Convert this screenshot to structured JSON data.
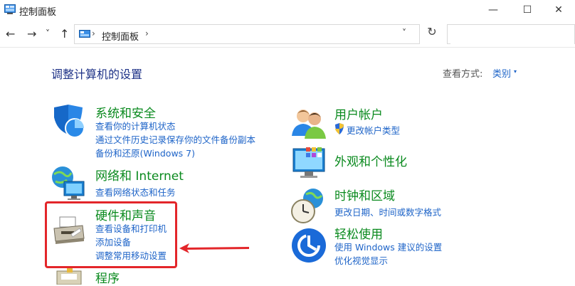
{
  "window": {
    "title": "控制面板",
    "minimize_glyph": "—",
    "maximize_glyph": "☐",
    "close_glyph": "✕"
  },
  "address_bar": {
    "back_glyph": "←",
    "forward_glyph": "→",
    "recent_glyph": "˅",
    "up_glyph": "↑",
    "path": "控制面板",
    "separator": "›",
    "dropdown_glyph": "˅",
    "refresh_glyph": "↻",
    "search_placeholder": ""
  },
  "main": {
    "heading": "调整计算机的设置",
    "view_by_label": "查看方式:",
    "view_by_value": "类别",
    "view_by_arrow": "▾"
  },
  "categories": [
    {
      "title": "系统和安全",
      "icon": "shield-icon",
      "links": [
        "查看你的计算机状态",
        "通过文件历史记录保存你的文件备份副本",
        "备份和还原(Windows 7)"
      ]
    },
    {
      "title": "网络和 Internet",
      "icon": "network-globe-icon",
      "links": [
        "查看网络状态和任务"
      ]
    },
    {
      "title": "硬件和声音",
      "icon": "printer-icon",
      "links": [
        "查看设备和打印机",
        "添加设备",
        "调整常用移动设置"
      ]
    },
    {
      "title": "程序",
      "icon": "programs-icon",
      "links": []
    },
    {
      "title": "用户帐户",
      "icon": "users-icon",
      "links": [
        "更改帐户类型"
      ]
    },
    {
      "title": "外观和个性化",
      "icon": "monitor-palette-icon",
      "links": []
    },
    {
      "title": "时钟和区域",
      "icon": "clock-globe-icon",
      "links": [
        "更改日期、时间或数字格式"
      ]
    },
    {
      "title": "轻松使用",
      "icon": "ease-of-access-icon",
      "links": [
        "使用 Windows 建议的设置",
        "优化视觉显示"
      ]
    }
  ],
  "colors": {
    "category_title": "#0a8a1e",
    "link": "#1e64c8",
    "heading": "#1e3287",
    "highlight": "#e3262a"
  }
}
